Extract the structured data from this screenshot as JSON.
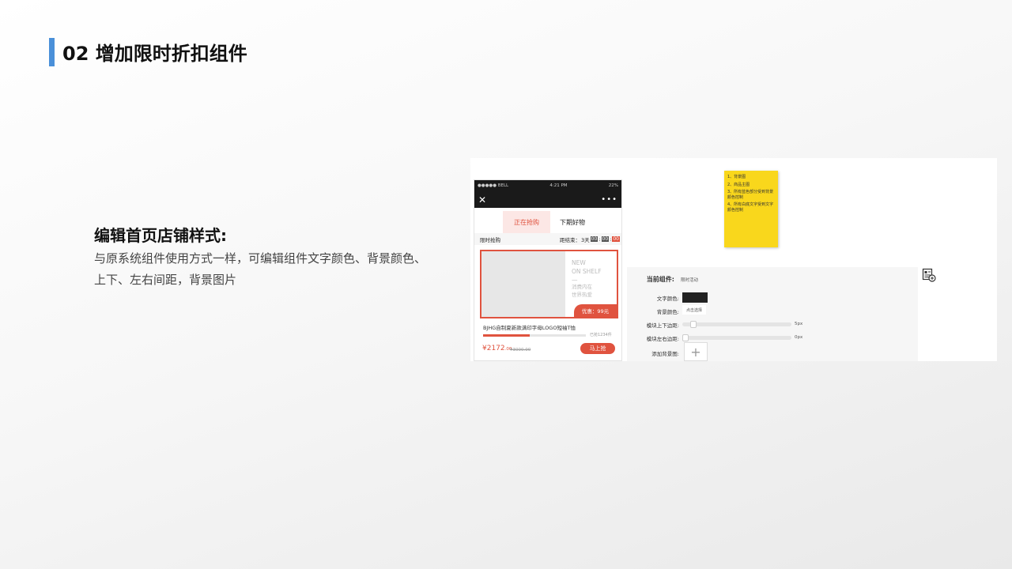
{
  "slide": {
    "title": "02 增加限时折扣组件",
    "accent_color": "#4a90d9"
  },
  "section": {
    "heading": "编辑首页店铺样式:",
    "description": "与原系统组件使用方式一样，可编辑组件文字颜色、背景颜色、上下、左右间距，背景图片"
  },
  "phone": {
    "status": {
      "carrier": "●●●●● BELL",
      "time": "4:21 PM",
      "battery": "22%"
    },
    "nav": {
      "close_icon": "close-icon",
      "more_icon": "more-icon"
    },
    "tabs": [
      "正在抢购",
      "下期好物"
    ],
    "sale_label": "限时抢购",
    "countdown": {
      "prefix": "距结束：",
      "days": "3天",
      "h": "00",
      "m": "00",
      "s": "00"
    },
    "card": {
      "tag_line1": "NEW",
      "tag_line2": "ON SHELF",
      "tag_dash": "—",
      "tag_line3": "消费内在",
      "tag_line4": "世界热爱",
      "promo": "优惠：99元"
    },
    "product_name": "BJHG自制夏新款满印字母LOGO短袖T恤",
    "progress_fraction": 0.45,
    "sold": "已抢1234件",
    "price_symbol": "¥",
    "price_int": "2172",
    "price_dec": ".00",
    "old_price": "¥3000.00",
    "buy_label": "马上抢",
    "brand_color": "#e0533f"
  },
  "note": {
    "items": [
      "1、背景图",
      "2、商品主图",
      "3、所有蓝色部分受到背景颜色控制",
      "4、所有白底文字受到文字颜色控制"
    ],
    "color": "#f9d71c"
  },
  "settings": {
    "current_label": "当前组件:",
    "current_value": "限时活动",
    "text_color_label": "文字颜色:",
    "bg_color_label": "背景颜色:",
    "bg_color_pick": "点击选择",
    "vertical_margin_label": "模块上下边距:",
    "vertical_margin_value": "5px",
    "horizontal_margin_label": "模块左右边距:",
    "horizontal_margin_value": "0px",
    "bg_image_label": "添加背景图:",
    "add_icon": "plus-icon"
  }
}
